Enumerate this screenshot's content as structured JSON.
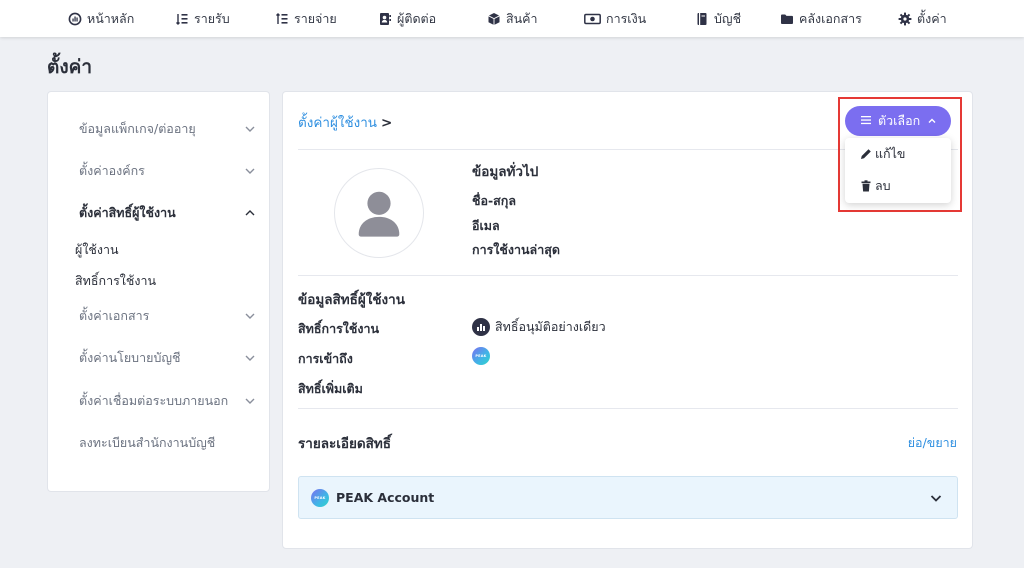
{
  "nav": {
    "items": [
      {
        "label": "หน้าหลัก",
        "icon": "dashboard-icon"
      },
      {
        "label": "รายรับ",
        "icon": "income-icon"
      },
      {
        "label": "รายจ่าย",
        "icon": "expense-icon"
      },
      {
        "label": "ผู้ติดต่อ",
        "icon": "contacts-icon"
      },
      {
        "label": "สินค้า",
        "icon": "product-box-icon"
      },
      {
        "label": "การเงิน",
        "icon": "money-icon"
      },
      {
        "label": "บัญชี",
        "icon": "book-icon"
      },
      {
        "label": "คลังเอกสาร",
        "icon": "folder-icon"
      },
      {
        "label": "ตั้งค่า",
        "icon": "gear-icon"
      }
    ]
  },
  "page": {
    "title": "ตั้งค่า"
  },
  "sidebar": {
    "items": [
      {
        "label": "ข้อมูลแพ็กเกจ/ต่ออายุ"
      },
      {
        "label": "ตั้งค่าองค์กร"
      },
      {
        "label": "ตั้งค่าสิทธิ์ผู้ใช้งาน"
      },
      {
        "label": "ตั้งค่าเอกสาร"
      },
      {
        "label": "ตั้งค่านโยบายบัญชี"
      },
      {
        "label": "ตั้งค่าเชื่อมต่อระบบภายนอก"
      },
      {
        "label": "ลงทะเบียนสำนักงานบัญชี"
      }
    ],
    "sub_items": [
      "ผู้ใช้งาน",
      "สิทธิ์การใช้งาน"
    ]
  },
  "main": {
    "breadcrumb": {
      "link": "ตั้งค่าผู้ใช้งาน",
      "separator": ">"
    },
    "general": {
      "heading": "ข้อมูลทั่วไป",
      "fields": [
        "ชื่อ-สกุล",
        "อีเมล",
        "การใช้งานล่าสุด"
      ]
    },
    "permissions": {
      "heading": "ข้อมูลสิทธิ์ผู้ใช้งาน",
      "usage_label": "สิทธิ์การใช้งาน",
      "usage_value": "สิทธิ์อนุมัติอย่างเดียว",
      "access_label": "การเข้าถึง",
      "extra_label": "สิทธิ์เพิ่มเติม"
    },
    "details": {
      "heading": "รายละเอียดสิทธิ์",
      "toggle": "ย่อ/ขยาย",
      "account_label": "PEAK Account",
      "logo_text": "PEAK"
    }
  },
  "options": {
    "button_label": "ตัวเลือก",
    "menu": [
      {
        "label": "แก้ไข",
        "icon": "pencil-icon"
      },
      {
        "label": "ลบ",
        "icon": "trash-icon"
      }
    ]
  },
  "colors": {
    "accent": "#7b6ef0",
    "link": "#2f8fe0",
    "highlight": "#e53935",
    "background": "#eef0f4"
  }
}
